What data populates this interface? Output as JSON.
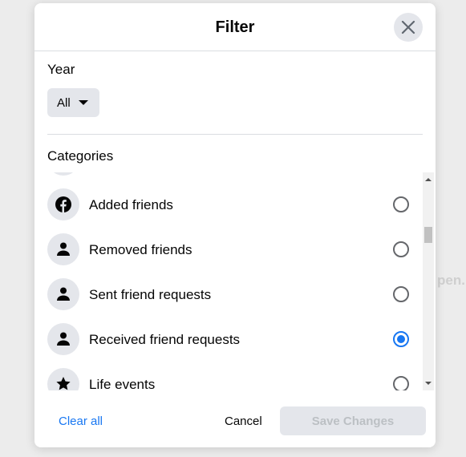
{
  "background_text": "pen.",
  "modal": {
    "title": "Filter",
    "close_icon": "close-icon"
  },
  "year": {
    "label": "Year",
    "selected": "All"
  },
  "categories": {
    "label": "Categories",
    "items": [
      {
        "label": "",
        "icon": "generic-icon",
        "selected": false
      },
      {
        "label": "Added friends",
        "icon": "facebook-icon",
        "selected": false
      },
      {
        "label": "Removed friends",
        "icon": "person-icon",
        "selected": false
      },
      {
        "label": "Sent friend requests",
        "icon": "person-icon",
        "selected": false
      },
      {
        "label": "Received friend requests",
        "icon": "person-icon",
        "selected": true
      },
      {
        "label": "Life events",
        "icon": "star-icon",
        "selected": false
      }
    ]
  },
  "footer": {
    "clear_all": "Clear all",
    "cancel": "Cancel",
    "save": "Save Changes"
  },
  "colors": {
    "accent": "#1877f2",
    "button_bg": "#e4e6eb"
  }
}
